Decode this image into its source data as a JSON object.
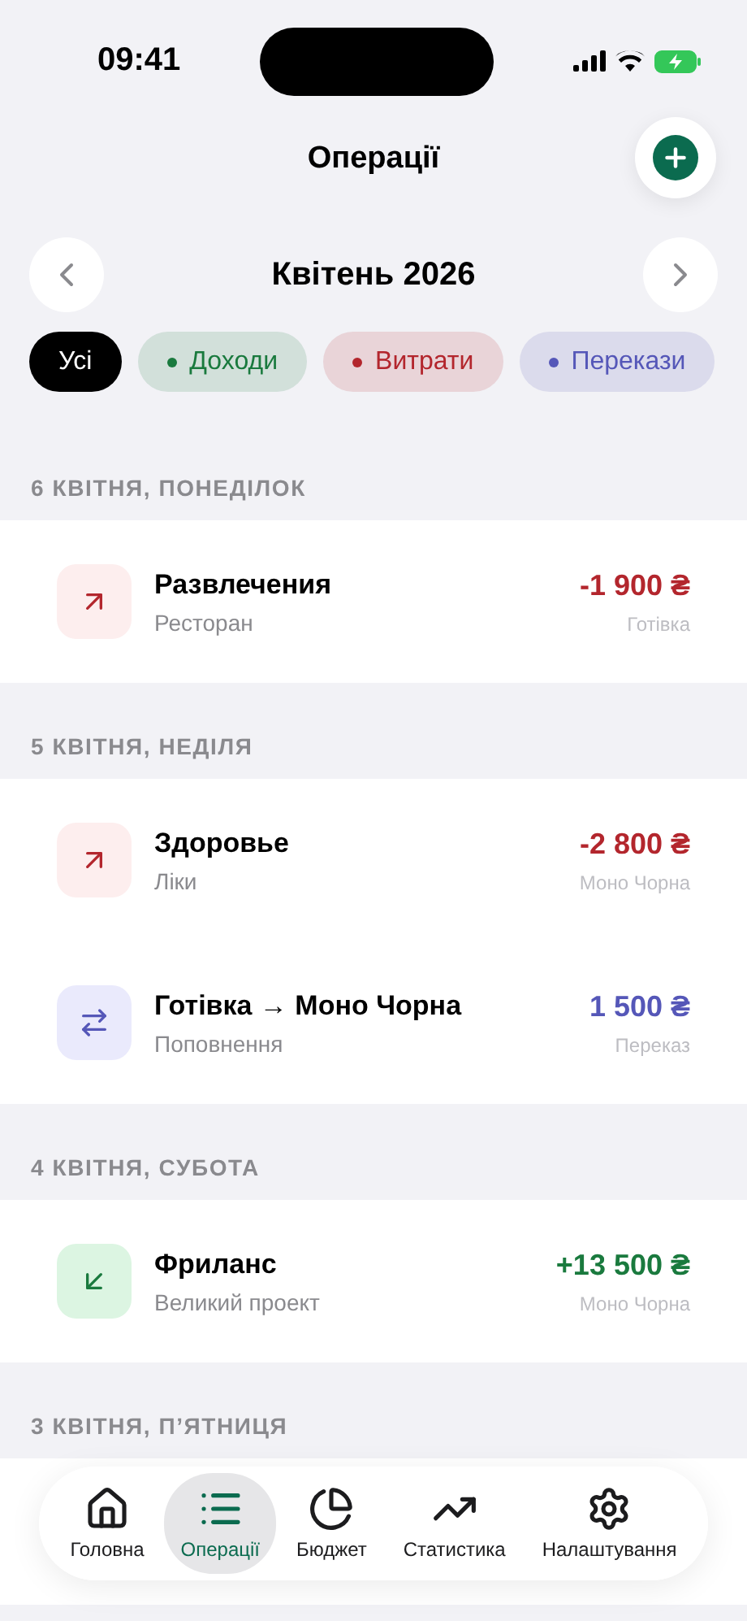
{
  "status_bar": {
    "time": "09:41"
  },
  "header": {
    "title": "Операції"
  },
  "month": {
    "label": "Квітень 2026"
  },
  "filters": [
    {
      "label": "Усі",
      "selected": true,
      "kind": "all",
      "color": "#000000"
    },
    {
      "label": "Доходи",
      "selected": false,
      "kind": "income",
      "color": "#1a7a3e"
    },
    {
      "label": "Витрати",
      "selected": false,
      "kind": "expense",
      "color": "#b3262d"
    },
    {
      "label": "Перекази",
      "selected": false,
      "kind": "transfer",
      "color": "#5557b8"
    }
  ],
  "sections": [
    {
      "date": "6 КВІТНЯ, ПОНЕДІЛОК",
      "transactions": [
        {
          "kind": "expense",
          "title": "Развлечения",
          "subtitle": "Ресторан",
          "amount": "-1 900 ₴",
          "account": "Готівка"
        }
      ]
    },
    {
      "date": "5 КВІТНЯ, НЕДІЛЯ",
      "transactions": [
        {
          "kind": "expense",
          "title": "Здоровье",
          "subtitle": "Ліки",
          "amount": "-2 800 ₴",
          "account": "Моно Чорна"
        },
        {
          "kind": "transfer",
          "title": "Готівка → Моно Чорна",
          "subtitle": "Поповнення",
          "amount": "1 500 ₴",
          "account": "Переказ"
        }
      ]
    },
    {
      "date": "4 КВІТНЯ, СУБОТА",
      "transactions": [
        {
          "kind": "income",
          "title": "Фриланс",
          "subtitle": "Великий проект",
          "amount": "+13 500 ₴",
          "account": "Моно Чорна"
        }
      ]
    },
    {
      "date": "3 КВІТНЯ, П’ЯТНИЦЯ"
    }
  ],
  "tab_bar": [
    {
      "label": "Головна",
      "selected": false,
      "kind": "home"
    },
    {
      "label": "Операції",
      "selected": true,
      "kind": "list"
    },
    {
      "label": "Бюджет",
      "selected": false,
      "kind": "pie"
    },
    {
      "label": "Статистика",
      "selected": false,
      "kind": "chart"
    },
    {
      "label": "Налаштування",
      "selected": false,
      "kind": "settings"
    }
  ]
}
